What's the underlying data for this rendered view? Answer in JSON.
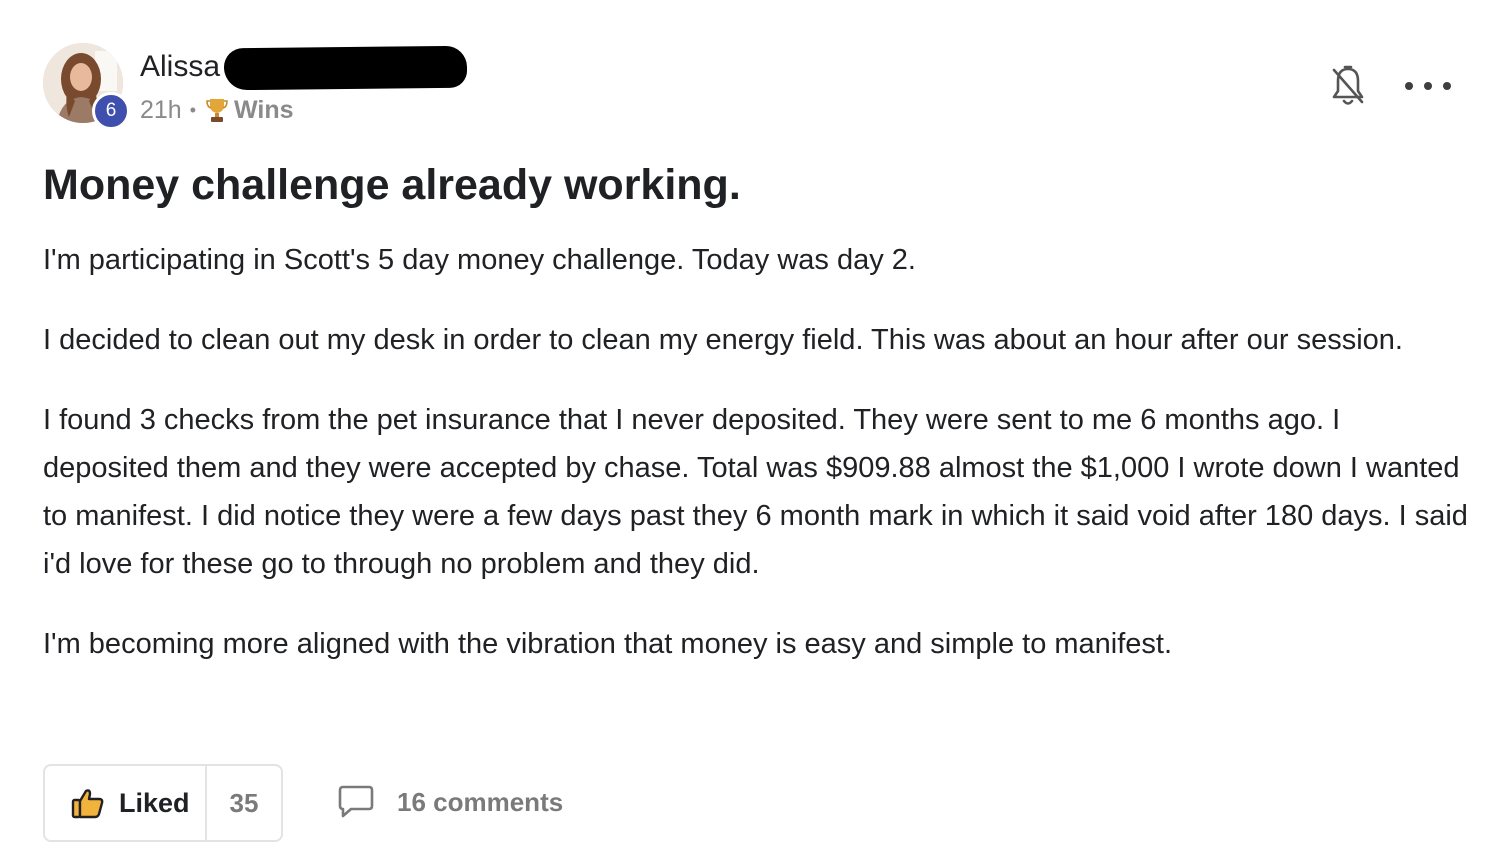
{
  "author": {
    "name": "Alissa",
    "level": "6",
    "time_ago": "21h",
    "category": "Wins"
  },
  "icons": {
    "avatar": "user-avatar-photo",
    "trophy": "trophy-icon",
    "bell": "bell-off-icon",
    "more": "more-horizontal-icon",
    "like": "thumbs-up-icon",
    "comment": "comment-bubble-icon"
  },
  "post": {
    "title": "Money challenge already working.",
    "paragraphs": [
      "I'm participating in Scott's 5 day money challenge. Today was day 2.",
      "I decided to clean out my desk in order to clean my energy field. This was about an hour after our session.",
      "I found 3 checks from the pet insurance that I never deposited. They were sent to me 6 months ago. I deposited them and they were accepted by chase. Total was $909.88 almost the $1,000 I wrote down I wanted to manifest. I did notice they were a few days past they 6 month mark in which it said void after 180 days. I said i'd love for these go to through no problem and they did.",
      "I'm becoming more aligned with the vibration that money is easy and simple to manifest."
    ]
  },
  "actions": {
    "like_label": "Liked",
    "like_count": "35",
    "comments_label": "16 comments"
  },
  "colors": {
    "level_badge": "#3f4fae",
    "text": "#202124",
    "muted": "#8a8a8a",
    "border": "#e3e3e3"
  }
}
